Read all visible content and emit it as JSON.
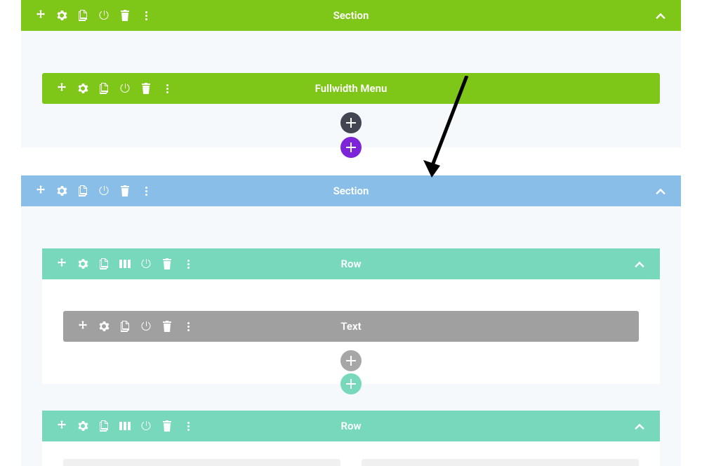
{
  "section1": {
    "label": "Section",
    "module": {
      "label": "Fullwidth Menu"
    }
  },
  "section2": {
    "label": "Section",
    "row1": {
      "label": "Row",
      "module": {
        "label": "Text"
      }
    },
    "row2": {
      "label": "Row"
    }
  },
  "colors": {
    "green": "#7ec617",
    "teal": "#77d8bc",
    "blue": "#89bee8",
    "gray": "#a0a0a0",
    "darkBtn": "#424552",
    "purple": "#7e24d9"
  }
}
